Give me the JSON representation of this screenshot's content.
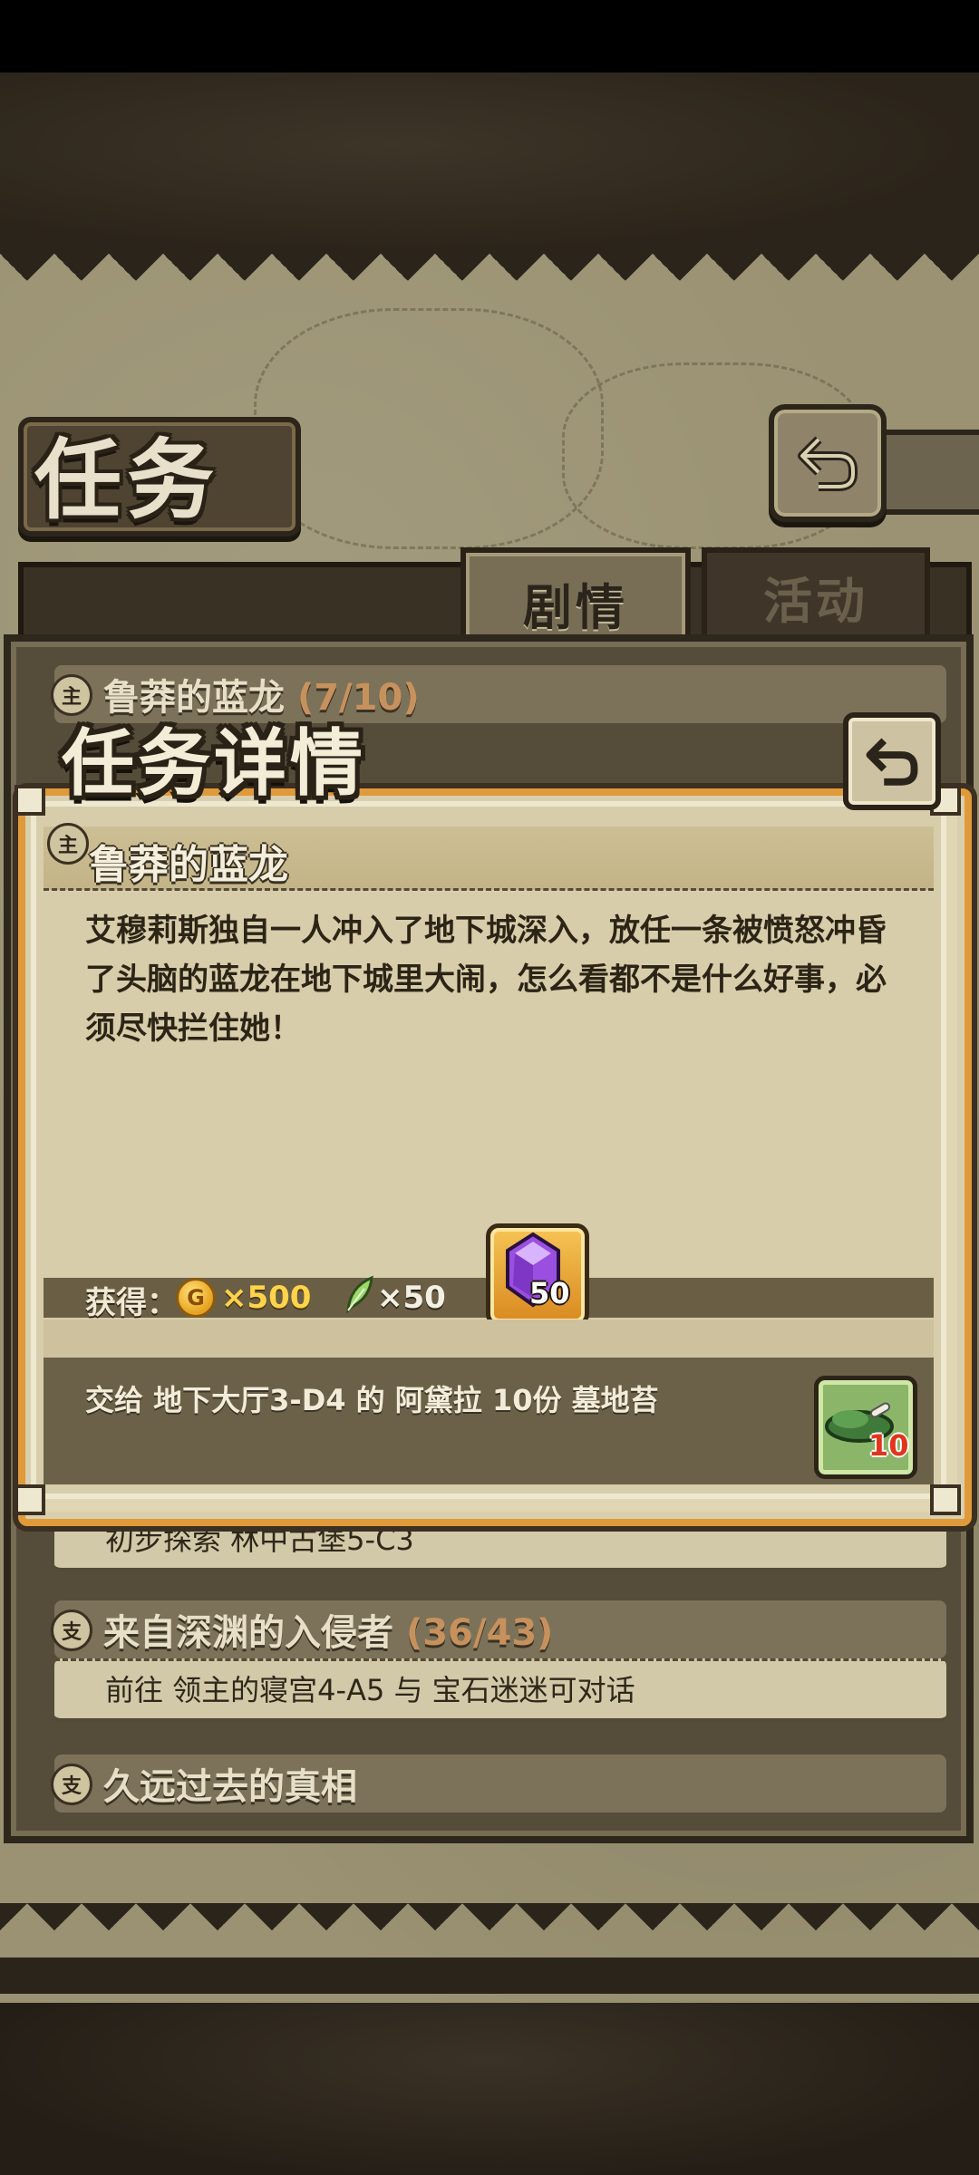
{
  "page": {
    "title": "任务",
    "tabs": [
      {
        "label": "剧情",
        "selected": true
      },
      {
        "label": "活动",
        "selected": false
      }
    ]
  },
  "quest_list": [
    {
      "badge": "主",
      "title": "鲁莽的蓝龙",
      "progress": "(7/10)"
    },
    {
      "badge": "",
      "title": "",
      "progress": "",
      "detail": "初步探索 林中古堡5-C3"
    },
    {
      "badge": "支",
      "title": "来自深渊的入侵者",
      "progress": "(36/43)",
      "detail": "前往 领主的寝宫4-A5 与 宝石迷迷可对话"
    },
    {
      "badge": "支",
      "title": "久远过去的真相",
      "progress": ""
    }
  ],
  "modal": {
    "title": "任务详情",
    "quest_badge": "主",
    "quest_name": "鲁莽的蓝龙",
    "description": "艾穆莉斯独自一人冲入了地下城深入，放任一条被愤怒冲昏了头脑的蓝龙在地下城里大闹，怎么看都不是什么好事，必须尽快拦住她！",
    "rewards_label": "获得：",
    "rewards": {
      "coin_symbol": "G",
      "coin_amount": "×500",
      "leaf_amount": "×50",
      "gem_count": "50"
    },
    "objective": "交给 地下大厅3-D4 的 阿黛拉 10份 墓地苔",
    "objective_item_count": "10"
  },
  "icons": {
    "back": "return-arrow-icon",
    "coin": "gold-coin-icon",
    "leaf": "leaf-icon",
    "gem": "purple-gem-icon",
    "item": "moss-item-icon"
  },
  "colors": {
    "accent_orange": "#e09a3a",
    "coin_gold": "#ffd34a",
    "progress_tan": "#c7915d",
    "count_red": "#e0361c"
  }
}
